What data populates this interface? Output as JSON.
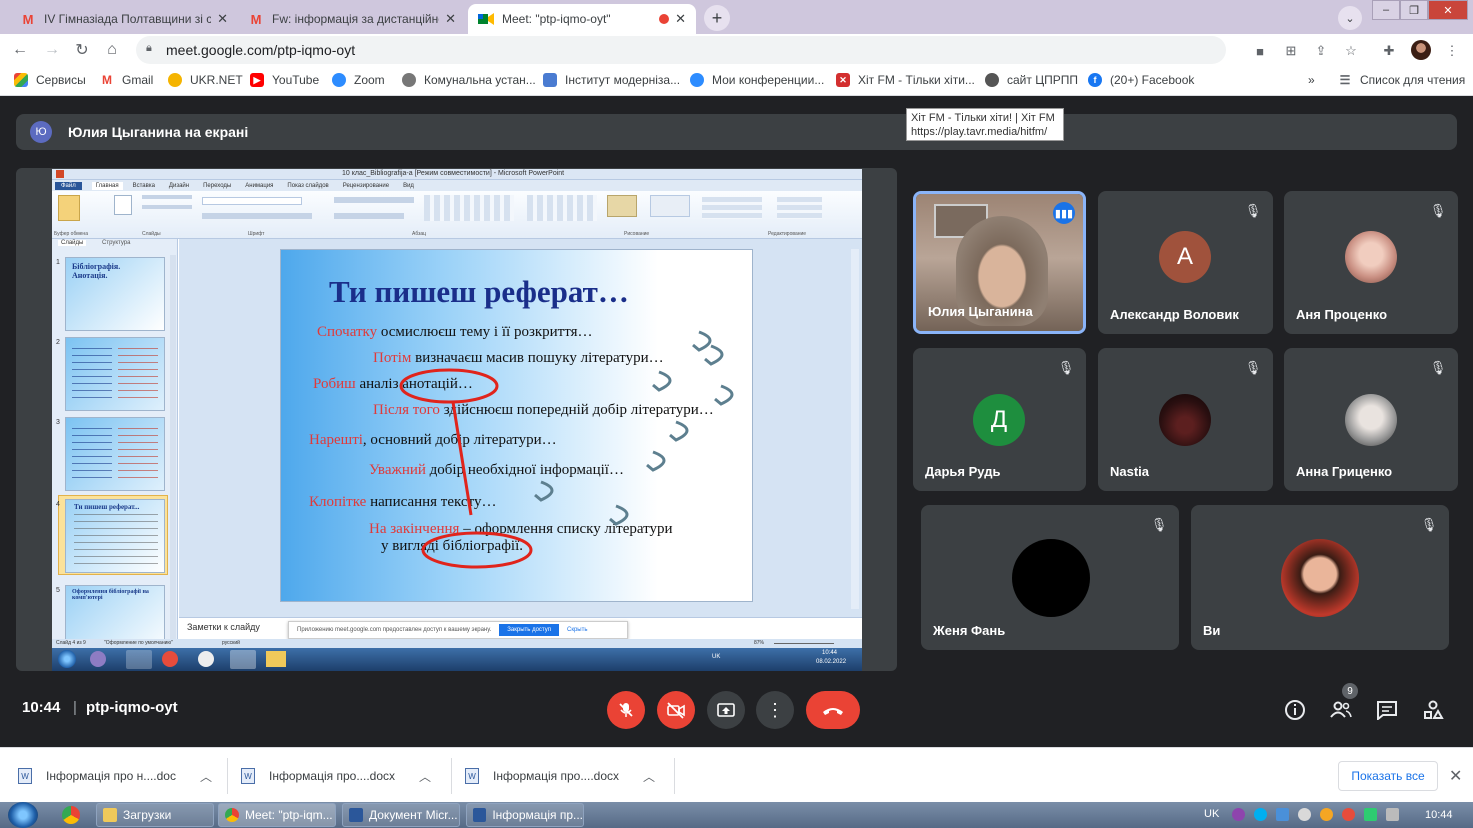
{
  "browser": {
    "tabs": [
      {
        "label": "IV Гімназіада Полтавщини зі сп",
        "icon": "gmail-icon"
      },
      {
        "label": "Fw: інформація за дистанційне",
        "icon": "gmail-icon"
      },
      {
        "label": "Meet: \"ptp-iqmo-oyt\"",
        "icon": "meet-icon"
      }
    ],
    "new_tab": "+",
    "url": "meet.google.com/ptp-iqmo-oyt",
    "bookmarks": [
      {
        "label": "Сервисы",
        "color": "#ea4335"
      },
      {
        "label": "Gmail",
        "color": "#ea4335"
      },
      {
        "label": "UKR.NET",
        "color": "#f5b400"
      },
      {
        "label": "YouTube",
        "color": "#ff0000"
      },
      {
        "label": "Zoom",
        "color": "#2d8cff"
      },
      {
        "label": "Комунальна устан...",
        "color": "#777777"
      },
      {
        "label": "Інститут модерніза...",
        "color": "#4a7bd1"
      },
      {
        "label": "Мои конференции...",
        "color": "#2d8cff"
      },
      {
        "label": "Хіт FM - Тільки хіти...",
        "color": "#d32f2f"
      },
      {
        "label": "сайт ЦПРПП",
        "color": "#555555"
      },
      {
        "label": "(20+) Facebook",
        "color": "#1877f2"
      }
    ],
    "bookmarks_more": "»",
    "reading_list": "Список для чтения",
    "tooltip_line1": "Хіт FM - Тільки хіти! | Хіт FM",
    "tooltip_line2": "https://play.tavr.media/hitfm/"
  },
  "meet": {
    "presenter_initial": "Ю",
    "presenter_text": "Юлия Цыганина на екрані",
    "participants": [
      {
        "name": "Юлия Цыганина",
        "initial": "",
        "avatar_color": "#6b7f91",
        "active": true
      },
      {
        "name": "Александр Воловик",
        "initial": "A",
        "avatar_color": "#a0523c"
      },
      {
        "name": "Аня Проценко",
        "initial": "",
        "avatar_color": "#c98f82"
      },
      {
        "name": "Дарья Рудь",
        "initial": "Д",
        "avatar_color": "#1e8e3e"
      },
      {
        "name": "Nastia",
        "initial": "",
        "avatar_color": "#3a1a1a"
      },
      {
        "name": "Анна Гриценко",
        "initial": "",
        "avatar_color": "#8d8d8d"
      },
      {
        "name": "Женя Фань",
        "initial": "",
        "avatar_color": "#000000"
      },
      {
        "name": "Ви",
        "initial": "",
        "avatar_color": "#c0392b"
      }
    ],
    "time": "10:44",
    "separator": "|",
    "meeting_code": "ptp-iqmo-oyt",
    "people_count": "9",
    "accent_red": "#ea4335"
  },
  "ppt": {
    "window_title": "10 клас_Bibliografija-a [Режим совместимости] - Microsoft PowerPoint",
    "ribbon_tabs": [
      "Файл",
      "Главная",
      "Вставка",
      "Дизайн",
      "Переходы",
      "Анимация",
      "Показ слайдов",
      "Рецензирование",
      "Вид"
    ],
    "ribbon_groups": [
      "Буфер обмена",
      "Слайды",
      "Шрифт",
      "Абзац",
      "Рисование",
      "Редактирование"
    ],
    "panel_tabs": [
      "Слайды",
      "Структура"
    ],
    "thumbnails": [
      {
        "num": "1",
        "title": "Бібліографія. Анотація."
      },
      {
        "num": "2",
        "title": ""
      },
      {
        "num": "3",
        "title": ""
      },
      {
        "num": "4",
        "title": "Ти пишеш реферат..."
      },
      {
        "num": "5",
        "title": "Оформлення бібліографії на комп'ютері"
      }
    ],
    "slide_title": "Ти пишеш реферат…",
    "slide_lines": [
      {
        "red": "Спочатку",
        "black": " осмислюєш тему і її розкриття…"
      },
      {
        "red": "Потім",
        "black": " визначаєш масив пошуку літератури…"
      },
      {
        "red": "Робиш",
        "black": " аналіз анотацій…"
      },
      {
        "red": "Після того",
        "black": " здійснюєш попередній добір літератури…"
      },
      {
        "red": "Нарешті",
        "black": ", основний добір літератури…"
      },
      {
        "red": "Уважний",
        "black": " добір необхідної інформації…"
      },
      {
        "red": "Клопітке",
        "black": " написання тексту…"
      },
      {
        "red": "На закінчення",
        "black": " – оформлення списку літератури"
      },
      {
        "red": "",
        "black": "у вигляді бібліографії."
      }
    ],
    "notes_placeholder": "Заметки к слайду",
    "share_notice": "Приложению meet.google.com предоставлен доступ к вашему экрану.",
    "share_stop": "Закрыть доступ",
    "share_hide": "Скрыть",
    "status_slide": "Слайд 4 из 9",
    "status_theme": "\"Оформление по умолчанию\"",
    "status_lang": "русский",
    "status_zoom": "87%",
    "win_lang": "UK",
    "win_time": "10:44",
    "win_date": "08.02.2022"
  },
  "downloads": {
    "items": [
      "Інформація про н....doc",
      "Інформація про....docx",
      "Інформація про....docx"
    ],
    "show_all": "Показать все",
    "close": "✕"
  },
  "taskbar": {
    "items": [
      "Загрузки",
      "Meet: \"ptp-iqm...",
      "Документ Micr...",
      "Інформація пр..."
    ],
    "lang": "UK",
    "clock": "10:44"
  }
}
